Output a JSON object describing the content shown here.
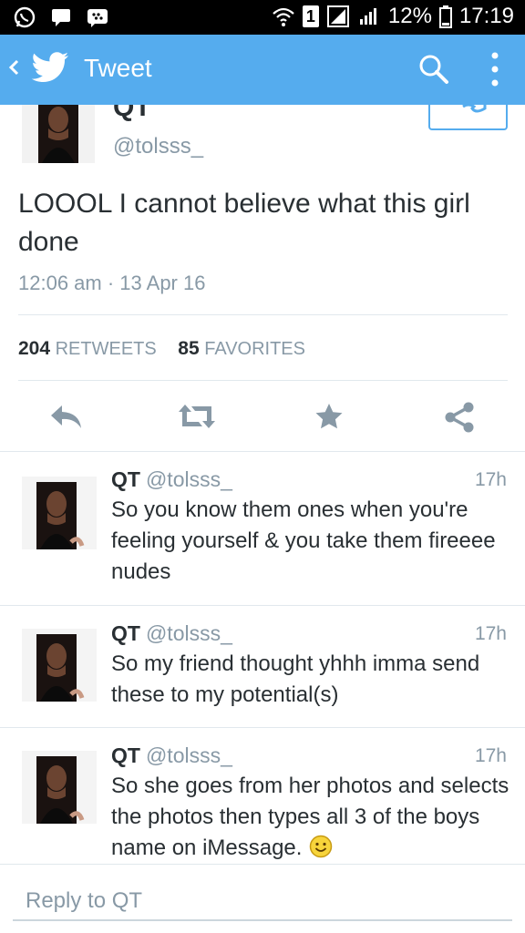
{
  "status_bar": {
    "icons": [
      "whatsapp-icon",
      "message-icon",
      "bbm-icon",
      "wifi-icon",
      "sim-icon",
      "signal-icon",
      "signal-icon",
      "battery-icon"
    ],
    "sim_slot": "1",
    "battery": "12%",
    "time": "17:19"
  },
  "app_bar": {
    "back_icon": "chevron-left-icon",
    "logo_icon": "twitter-bird-icon",
    "title": "Tweet",
    "search_icon": "search-icon",
    "more_icon": "more-vertical-icon"
  },
  "tweet": {
    "author_name": "QT",
    "author_handle": "@tolsss_",
    "text": "LOOOL I cannot believe what this girl done",
    "timestamp": "12:06 am · 13 Apr 16",
    "retweets_count": "204",
    "retweets_label": "RETWEETS",
    "favorites_count": "85",
    "favorites_label": "FAVORITES",
    "actions": [
      "reply-icon",
      "retweet-icon",
      "favorite-icon",
      "share-icon"
    ]
  },
  "replies": [
    {
      "name": "QT",
      "handle": "@tolsss_",
      "time": "17h",
      "text": "So you know them ones when you're feeling yourself & you take them fireeee nudes"
    },
    {
      "name": "QT",
      "handle": "@tolsss_",
      "time": "17h",
      "text": "So my friend thought yhhh imma send these to my potential(s)"
    },
    {
      "name": "QT",
      "handle": "@tolsss_",
      "time": "17h",
      "text": "So she goes from her photos and selects the photos then types all 3 of the boys name on iMessage.",
      "emoji": "smiley-emoji-icon"
    }
  ],
  "reply_box": {
    "placeholder": "Reply to QT"
  },
  "colors": {
    "brand": "#55acee",
    "text": "#292f33",
    "muted": "#8899a6",
    "divider": "#e1e8ed",
    "icon": "#8899a6"
  }
}
